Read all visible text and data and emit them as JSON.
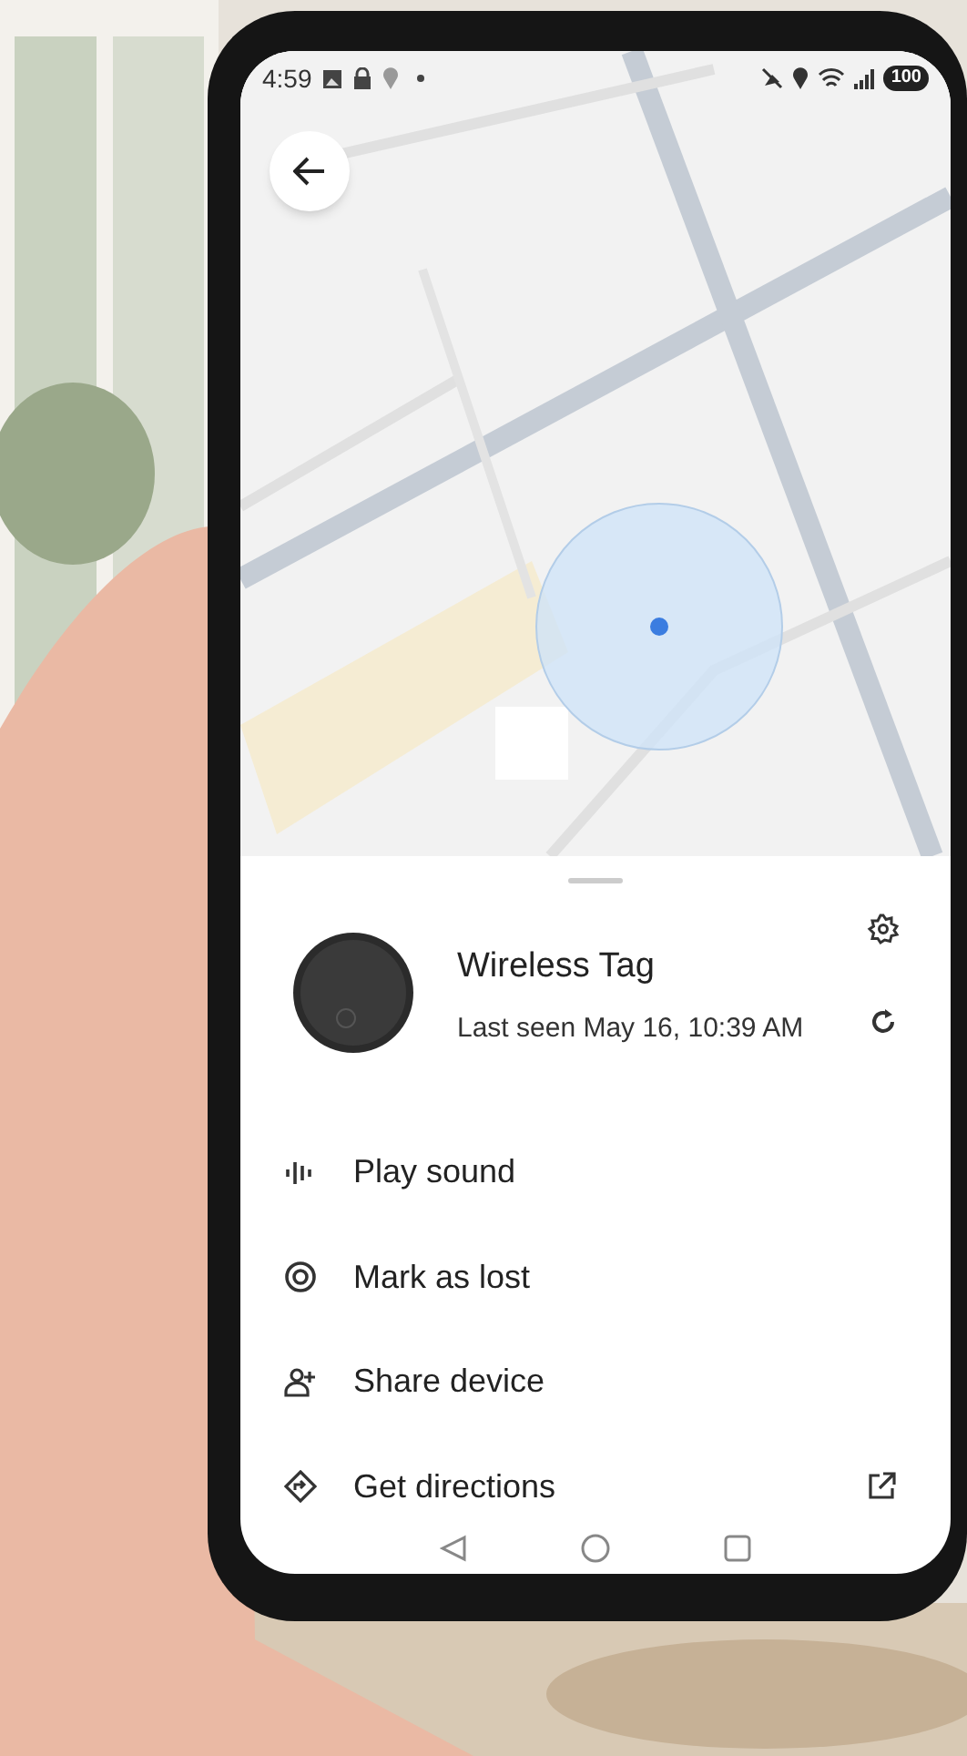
{
  "status_bar": {
    "time": "4:59",
    "battery": "100"
  },
  "device": {
    "name": "Wireless Tag",
    "last_seen": "Last seen May 16, 10:39 AM"
  },
  "actions": [
    {
      "kind": "sound",
      "label": "Play sound",
      "external": false
    },
    {
      "kind": "lost",
      "label": "Mark as lost",
      "external": false
    },
    {
      "kind": "share",
      "label": "Share device",
      "external": false
    },
    {
      "kind": "directions",
      "label": "Get directions",
      "external": true
    }
  ]
}
